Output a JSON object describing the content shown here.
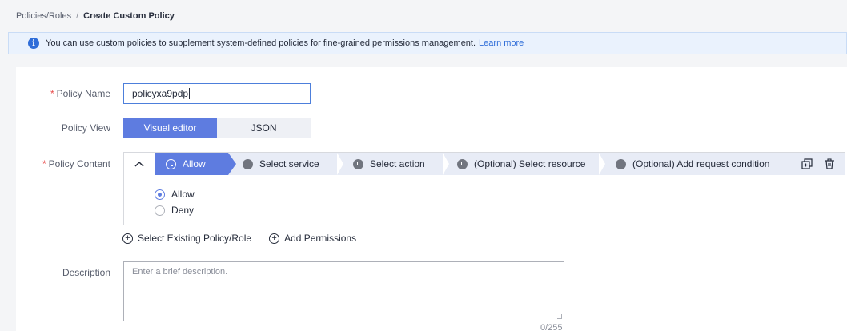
{
  "breadcrumb": {
    "parent": "Policies/Roles",
    "separator": "/",
    "current": "Create Custom Policy"
  },
  "banner": {
    "text": "You can use custom policies to supplement system-defined policies for fine-grained permissions management.",
    "link": "Learn more",
    "icon": "info-icon"
  },
  "form": {
    "policy_name": {
      "label": "Policy Name",
      "required_mark": "*",
      "value": "policyxa9pdp"
    },
    "policy_view": {
      "label": "Policy View",
      "options": [
        "Visual editor",
        "JSON"
      ],
      "selected": "Visual editor"
    },
    "policy_content": {
      "label": "Policy Content",
      "required_mark": "*",
      "collapse_glyph": "^",
      "steps": [
        "Allow",
        "Select service",
        "Select action",
        "(Optional) Select resource",
        "(Optional) Add request condition"
      ],
      "effect_options": [
        "Allow",
        "Deny"
      ],
      "effect_selected": "Allow"
    },
    "actions": {
      "select_existing": "Select Existing Policy/Role",
      "add_permissions": "Add Permissions"
    },
    "description": {
      "label": "Description",
      "placeholder": "Enter a brief description.",
      "counter": "0/255"
    }
  },
  "colors": {
    "primary": "#5e7ce0",
    "link": "#2f6dd8",
    "required": "#e84a4a",
    "banner_bg": "#eaf2fd"
  }
}
